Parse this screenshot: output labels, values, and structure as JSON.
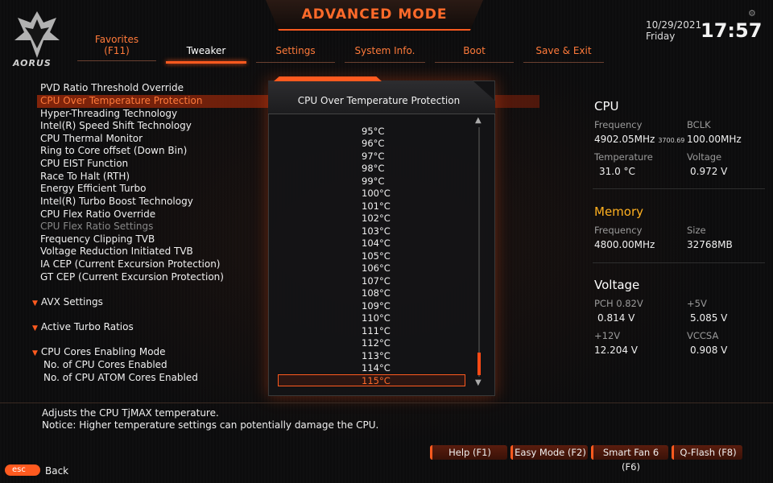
{
  "header": {
    "title": "ADVANCED MODE",
    "logo_text": "AORUS",
    "date": "10/29/2021",
    "weekday": "Friday",
    "time": "17:57"
  },
  "tabs": [
    {
      "line1": "Favorites",
      "line2": "(F11)"
    },
    {
      "line1": "Tweaker"
    },
    {
      "line1": "Settings"
    },
    {
      "line1": "System Info."
    },
    {
      "line1": "Boot"
    },
    {
      "line1": "Save & Exit"
    }
  ],
  "settings": [
    "PVD Ratio Threshold Override",
    "CPU Over Temperature Protection",
    "Hyper-Threading Technology",
    "Intel(R) Speed Shift Technology",
    "CPU Thermal Monitor",
    "Ring to Core offset (Down Bin)",
    "CPU EIST Function",
    "Race To Halt (RTH)",
    "Energy Efficient Turbo",
    "Intel(R) Turbo Boost Technology",
    "CPU Flex Ratio Override",
    "CPU Flex Ratio Settings",
    "Frequency Clipping TVB",
    "Voltage Reduction Initiated TVB",
    "IA CEP (Current Excursion Protection)",
    "GT CEP (Current Excursion Protection)"
  ],
  "sections": [
    "AVX Settings",
    "Active Turbo Ratios",
    "CPU Cores Enabling Mode"
  ],
  "sub_settings": [
    "No. of CPU Cores Enabled",
    "No. of CPU ATOM Cores Enabled"
  ],
  "popup": {
    "title": "CPU Over Temperature Protection",
    "options": [
      "95°C",
      "96°C",
      "97°C",
      "98°C",
      "99°C",
      "100°C",
      "101°C",
      "102°C",
      "103°C",
      "104°C",
      "105°C",
      "106°C",
      "107°C",
      "108°C",
      "109°C",
      "110°C",
      "111°C",
      "112°C",
      "113°C",
      "114°C"
    ],
    "selected": "115°C"
  },
  "cpu": {
    "title": "CPU",
    "freq_label": "Frequency",
    "freq_value": "4902.05MHz",
    "freq_sub": "3700.69",
    "bclk_label": "BCLK",
    "bclk_value": "100.00MHz",
    "temp_label": "Temperature",
    "temp_value": "31.0 °C",
    "volt_label": "Voltage",
    "volt_value": "0.972 V"
  },
  "memory": {
    "title": "Memory",
    "freq_label": "Frequency",
    "freq_value": "4800.00MHz",
    "size_label": "Size",
    "size_value": "32768MB"
  },
  "voltage": {
    "title": "Voltage",
    "pch_label": "PCH 0.82V",
    "pch_value": "0.814 V",
    "v5_label": "+5V",
    "v5_value": "5.085 V",
    "v12_label": "+12V",
    "v12_value": "12.204 V",
    "vccsa_label": "VCCSA",
    "vccsa_value": "0.908 V"
  },
  "help": {
    "line1": "Adjusts the CPU TjMAX temperature.",
    "line2": "Notice: Higher temperature settings can potentially damage the CPU."
  },
  "footer": {
    "help_btn": "Help (F1)",
    "easy_btn": "Easy Mode (F2)",
    "fan_btn": "Smart Fan 6 (F6)",
    "qflash_btn": "Q-Flash (F8)",
    "esc_label": "esc",
    "back_label": "Back"
  },
  "colors": {
    "accent": "#ff5a1f",
    "memory_title": "#ffb020"
  }
}
